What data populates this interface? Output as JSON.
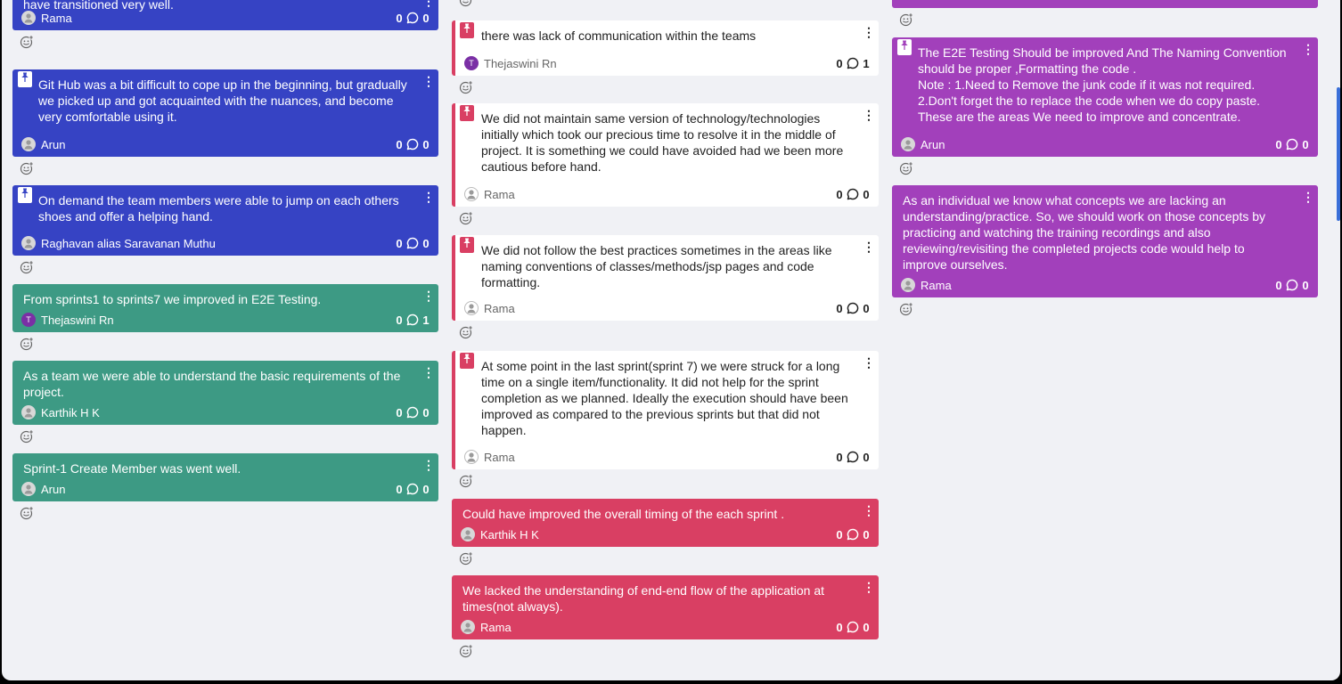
{
  "columns": [
    {
      "cards": [
        {
          "text": "have transitioned very well.",
          "author": "Rama",
          "likes": "0",
          "comments": "0",
          "color": "blue",
          "pinned": false,
          "avatar": "gray"
        },
        {
          "text": "Git Hub was a bit difficult to cope up in the beginning, but gradually we picked up and got acquainted with the nuances, and become very comfortable using it.",
          "author": "Arun",
          "likes": "0",
          "comments": "0",
          "color": "blue",
          "pinned": true,
          "avatar": "gray"
        },
        {
          "text": "On demand the team members were able to jump on each others shoes and offer a helping hand.",
          "author": "Raghavan alias Saravanan Muthu",
          "likes": "0",
          "comments": "0",
          "color": "blue",
          "pinned": true,
          "avatar": "gray"
        },
        {
          "text": "From sprints1 to sprints7 we improved in E2E Testing.",
          "author": "Thejaswini Rn",
          "likes": "0",
          "comments": "1",
          "color": "green",
          "pinned": false,
          "avatar": "T"
        },
        {
          "text": "As a team we were able to understand the basic requirements of the project.",
          "author": "Karthik H K",
          "likes": "0",
          "comments": "0",
          "color": "green",
          "pinned": false,
          "avatar": "gray"
        },
        {
          "text": "Sprint-1 Create Member was went well.",
          "author": "Arun",
          "likes": "0",
          "comments": "0",
          "color": "green",
          "pinned": false,
          "avatar": "gray"
        }
      ]
    },
    {
      "cards": [
        {
          "text": "there was lack of communication within the teams",
          "author": "Thejaswini Rn",
          "likes": "0",
          "comments": "1",
          "color": "white",
          "pinned": true,
          "avatar": "T"
        },
        {
          "text": "We did not maintain same version of technology/technologies initially which took our precious time to resolve it in the middle of project. It is something we could have avoided had we been more cautious before hand.",
          "author": "Rama",
          "likes": "0",
          "comments": "0",
          "color": "white",
          "pinned": true,
          "avatar": "gray"
        },
        {
          "text": "We did not follow the best practices sometimes in the areas like naming conventions of classes/methods/jsp pages and code formatting.",
          "author": "Rama",
          "likes": "0",
          "comments": "0",
          "color": "white",
          "pinned": true,
          "avatar": "gray"
        },
        {
          "text": "At some point in the last sprint(sprint 7) we were struck for a long time on a single item/functionality. It did not help for the sprint completion as we planned. Ideally the execution should have been improved as compared to the previous sprints but that did not happen.",
          "author": "Rama",
          "likes": "0",
          "comments": "0",
          "color": "white",
          "pinned": true,
          "avatar": "gray"
        },
        {
          "text": "Could have improved the overall timing of the each sprint .",
          "author": "Karthik H K",
          "likes": "0",
          "comments": "0",
          "color": "red",
          "pinned": false,
          "avatar": "gray"
        },
        {
          "text": "We lacked the understanding of end-end flow of the application at times(not always).",
          "author": "Rama",
          "likes": "0",
          "comments": "0",
          "color": "red",
          "pinned": false,
          "avatar": "gray"
        }
      ]
    },
    {
      "cards": [
        {
          "text": "The E2E Testing Should be improved And The Naming Convention should be proper ,Formatting the code .\nNote : 1.Need to Remove the junk code if it was not required.\n2.Don't forget the to replace the code when we do copy paste.\nThese are the areas We need to improve and concentrate.",
          "author": "Arun",
          "likes": "0",
          "comments": "0",
          "color": "purple",
          "pinned": true,
          "avatar": "gray"
        },
        {
          "text": "As an individual we know what concepts we are lacking an understanding/practice. So, we should work on those concepts by practicing and watching the training recordings and also reviewing/revisiting the completed projects code would help to improve ourselves.",
          "author": "Rama",
          "likes": "0",
          "comments": "0",
          "color": "purple",
          "pinned": false,
          "avatar": "gray"
        }
      ]
    }
  ],
  "icons": {
    "menu": "more-vertical-icon",
    "pin": "pin-icon",
    "comment": "comment-bubble-icon",
    "react": "add-reaction-icon",
    "avatar": "user-avatar-icon"
  },
  "colors": {
    "blue": "#3643c4",
    "green": "#3d9a84",
    "red": "#d93f63",
    "purple": "#a240bb",
    "background": "#f0f1f5"
  }
}
